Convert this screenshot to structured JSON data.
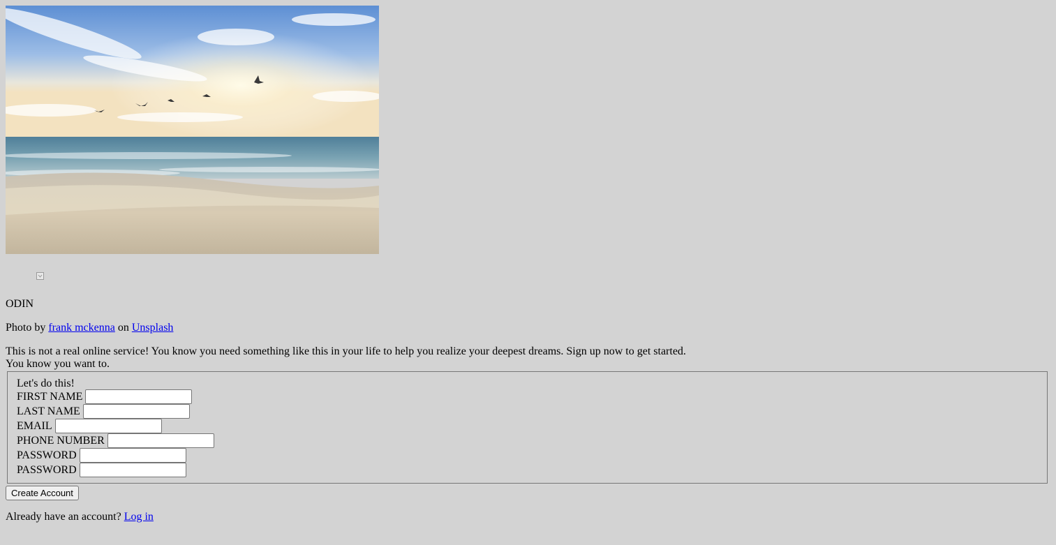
{
  "brand": {
    "name": "ODIN"
  },
  "credit": {
    "prefix": "Photo by",
    "author": "frank mckenna",
    "middle": "on",
    "site": "Unsplash"
  },
  "pitch": {
    "line1": "This is not a real online service! You know you need something like this in your life to help you realize your deepest dreams. Sign up now to get started.",
    "line2": "You know you want to."
  },
  "form": {
    "legend": "Let's do this!",
    "fields": [
      {
        "label": "FIRST NAME",
        "value": ""
      },
      {
        "label": "LAST NAME",
        "value": ""
      },
      {
        "label": "EMAIL",
        "value": ""
      },
      {
        "label": "PHONE NUMBER",
        "value": ""
      },
      {
        "label": "PASSWORD",
        "value": ""
      },
      {
        "label": "PASSWORD",
        "value": ""
      }
    ],
    "submit_label": "Create Account"
  },
  "login": {
    "prompt": "Already have an account?",
    "link": "Log in"
  }
}
